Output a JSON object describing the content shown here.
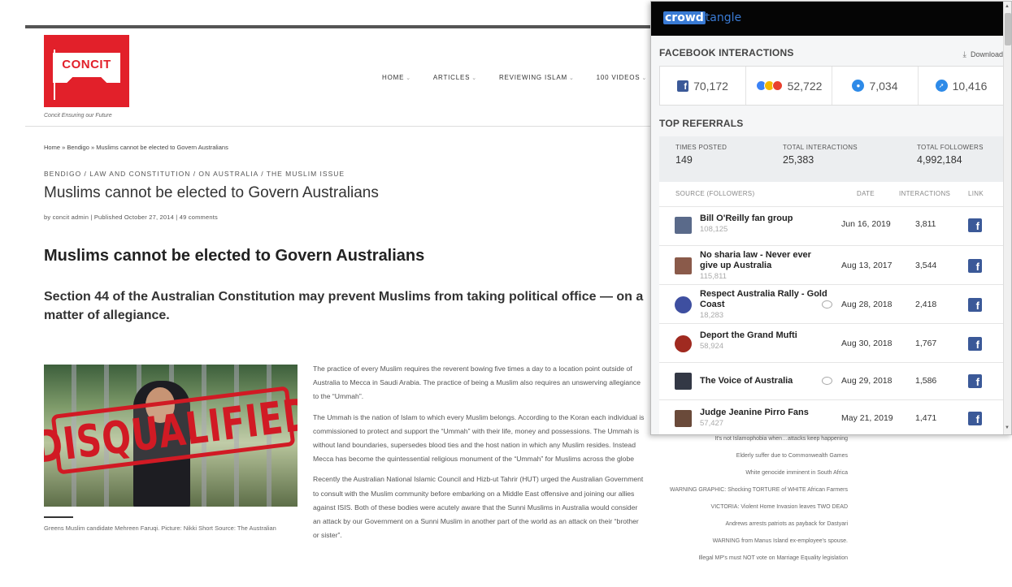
{
  "site": {
    "logo_text": "CONCIT",
    "tagline": "Concit Ensuring our Future",
    "nav": [
      "HOME",
      "ARTICLES",
      "REVIEWING ISLAM",
      "100 VIDEOS"
    ]
  },
  "article": {
    "breadcrumb": [
      "Home",
      "Bendigo",
      "Muslims cannot be elected to Govern Australians"
    ],
    "categories": "BENDIGO / LAW AND CONSTITUTION / ON AUSTRALIA / THE MUSLIM ISSUE",
    "title": "Muslims cannot be elected to Govern Australians",
    "byline": "by concit admin  |  Published October 27, 2014  |  49 comments",
    "heading": "Muslims cannot be elected to Govern Australians",
    "subheading": "Section 44 of the Australian Constitution may prevent Muslims from taking political office — on a matter of allegiance.",
    "image_stamp": "DISQUALIFIED",
    "caption": "Greens Muslim candidate Mehreen Faruqi. Picture: Nikki Short Source: The Australian",
    "paragraphs": [
      "The practice of every Muslim requires the reverent bowing five times a day to a location point outside of Australia to Mecca in Saudi Arabia. The practice of being a Muslim also requires an unswerving allegiance to the “Ummah”.",
      "The Ummah is the nation of Islam to which every Muslim belongs. According to the Koran each individual is commissioned to protect and support the “Ummah” with their life, money and possessions. The Ummah is without land boundaries, supersedes blood ties and the host nation in which any Muslim resides. Instead Mecca has become the quintessential religious monument of the “Ummah” for Muslims across the globe",
      "Recently the Australian National Islamic Council and Hizb-ut Tahrir (HUT) urged the Australian Government to consult with the Muslim community before embarking on a Middle East offensive and joining our allies against ISIS. Both of these bodies were acutely aware that the Sunni Muslims in Australia would consider an attack by our Government on a Sunni Muslim in another part of the world as an attack on their “brother or sister”."
    ]
  },
  "sidebar_links": [
    "It's not Islamophobia when…attacks keep happening",
    "Elderly suffer due to Commonwealth Games",
    "White genocide imminent in South Africa",
    "WARNING GRAPHIC: Shocking TORTURE of WHITE African Farmers",
    "VICTORIA: Violent Home Invasion leaves TWO DEAD",
    "Andrews arrests patriots as payback for Dastyari",
    "WARNING from Manus Island ex-employee's spouse.",
    "Illegal MP's must NOT vote on Marriage Equality legislation"
  ],
  "crowdtangle": {
    "logo_a": "crowd",
    "logo_b": "tangle",
    "fb_title": "FACEBOOK INTERACTIONS",
    "download": "Download",
    "metrics": [
      "70,172",
      "52,722",
      "7,034",
      "10,416"
    ],
    "ref_title": "TOP REFERRALS",
    "totals": [
      {
        "label": "TIMES POSTED",
        "value": "149"
      },
      {
        "label": "TOTAL INTERACTIONS",
        "value": "25,383"
      },
      {
        "label": "TOTAL FOLLOWERS",
        "value": "4,992,184"
      }
    ],
    "columns": [
      "SOURCE (FOLLOWERS)",
      "DATE",
      "INTERACTIONS",
      "LINK"
    ],
    "rows": [
      {
        "name": "Bill O'Reilly fan group",
        "followers": "108,125",
        "date": "Jun 16, 2019",
        "interactions": "3,811"
      },
      {
        "name": "No sharia law - Never ever give up Australia",
        "followers": "115,811",
        "date": "Aug 13, 2017",
        "interactions": "3,544"
      },
      {
        "name": "Respect Australia Rally - Gold Coast",
        "followers": "18,283",
        "date": "Aug 28, 2018",
        "interactions": "2,418"
      },
      {
        "name": "Deport the Grand Mufti",
        "followers": "58,924",
        "date": "Aug 30, 2018",
        "interactions": "1,767"
      },
      {
        "name": "The Voice of Australia",
        "followers": "",
        "date": "Aug 29, 2018",
        "interactions": "1,586"
      },
      {
        "name": "Judge Jeanine Pirro Fans",
        "followers": "57,427",
        "date": "May 21, 2019",
        "interactions": "1,471"
      }
    ],
    "colors": {
      "facebook": "#3b5998",
      "header": "#050505",
      "accent": "#3a7bd5"
    }
  }
}
